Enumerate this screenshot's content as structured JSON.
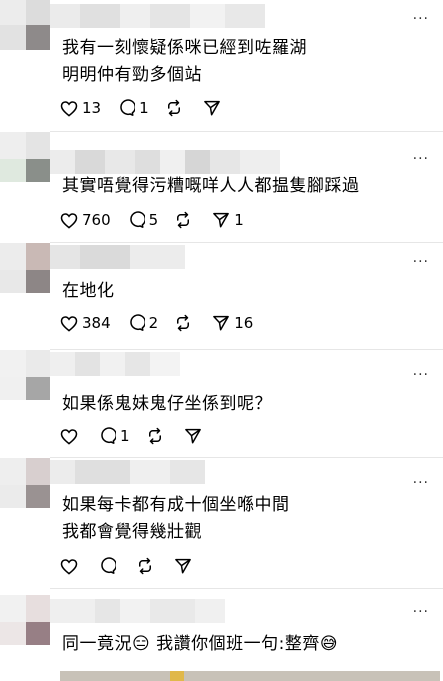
{
  "comments": [
    {
      "text": "我有一刻懷疑係咪已經到咗羅湖\n明明仲有勁多個站",
      "likes": "13",
      "replies": "1",
      "reposts": "",
      "shares": ""
    },
    {
      "text": "其實唔覺得污糟嘅咩人人都揾隻腳踩過",
      "likes": "760",
      "replies": "5",
      "reposts": "",
      "shares": "1"
    },
    {
      "text": "在地化",
      "likes": "384",
      "replies": "2",
      "reposts": "",
      "shares": "16"
    },
    {
      "text": "如果係鬼妹鬼仔坐係到呢？",
      "likes": "",
      "replies": "1",
      "reposts": "",
      "shares": ""
    },
    {
      "text": "如果每卡都有成十個坐喺中間\n我都會覺得幾壯觀",
      "likes": "",
      "replies": "",
      "reposts": "",
      "shares": ""
    },
    {
      "text": "同一竟況😑 我讚你個班一句:整齊😅",
      "likes": "",
      "replies": "",
      "reposts": "",
      "shares": ""
    }
  ],
  "more_label": "···",
  "icons": [
    "heart-icon",
    "comment-icon",
    "repost-icon",
    "share-icon",
    "more-icon"
  ],
  "colors": {
    "text": "#000000",
    "divider": "#e6e6e6",
    "blur_gray": "#d9d9d9"
  }
}
